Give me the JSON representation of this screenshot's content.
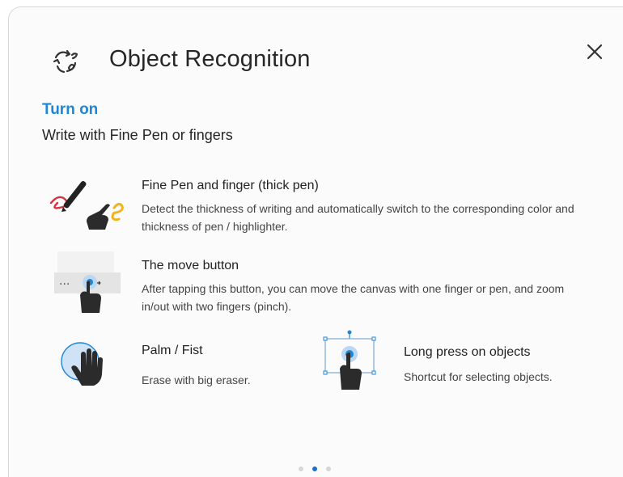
{
  "dialog": {
    "title": "Object Recognition",
    "header_icon": "object-recognition-icon",
    "close_icon": "close-icon"
  },
  "turn_on_label": "Turn on",
  "subtitle": "Write with Fine Pen or fingers",
  "features": [
    {
      "title": "Fine Pen and finger (thick pen)",
      "description": "Detect the thickness of writing and automatically switch to the corresponding color and thickness of pen / highlighter.",
      "icon": "pen-and-finger-icon"
    },
    {
      "title": "The move button",
      "description": "After tapping this button, you can move the canvas with one finger or pen, and zoom in/out with two fingers (pinch).",
      "icon": "move-button-icon"
    },
    {
      "title": "Palm / Fist",
      "description": "Erase with big eraser.",
      "icon": "palm-icon"
    },
    {
      "title": "Long press on objects",
      "description": "Shortcut for selecting objects.",
      "icon": "long-press-icon"
    }
  ],
  "pager": {
    "count": 3,
    "active_index": 1
  },
  "colors": {
    "accent": "#1f86d6",
    "pager_active": "#1f6fc8",
    "pen_red": "#d9303f",
    "finger_yellow": "#f2b31b"
  }
}
